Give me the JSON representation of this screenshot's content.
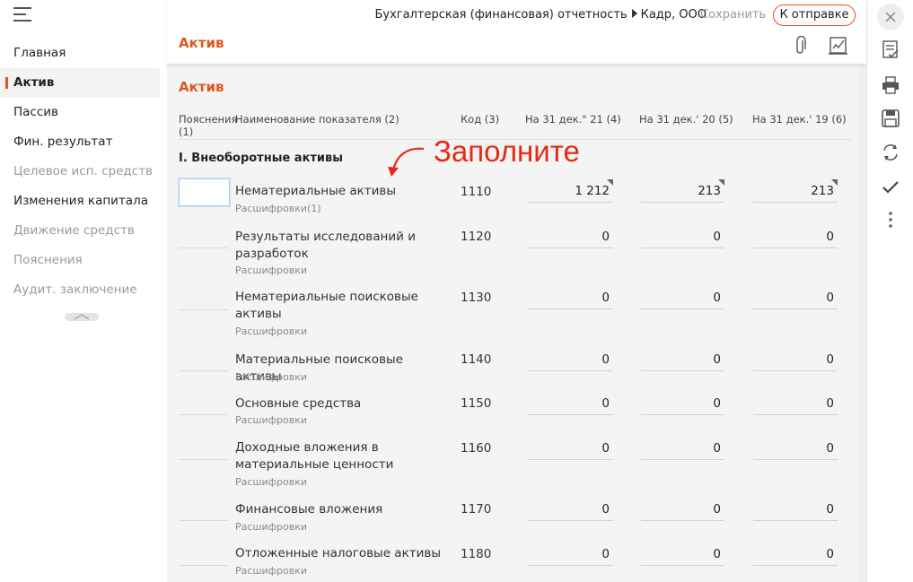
{
  "sidebar": {
    "items": [
      {
        "label": "Главная",
        "state": "normal"
      },
      {
        "label": "Актив",
        "state": "active"
      },
      {
        "label": "Пассив",
        "state": "normal"
      },
      {
        "label": "Фин. результат",
        "state": "normal"
      },
      {
        "label": "Целевое исп. средств",
        "state": "muted"
      },
      {
        "label": "Изменения капитала",
        "state": "normal"
      },
      {
        "label": "Движение средств",
        "state": "muted"
      },
      {
        "label": "Пояснения",
        "state": "muted"
      },
      {
        "label": "Аудит. заключение",
        "state": "muted"
      }
    ]
  },
  "header": {
    "breadcrumb_doc": "Бухгалтерская (финансовая) отчетность",
    "breadcrumb_org": "Кадр, ООО",
    "save_label": "Сохранить",
    "send_label": "К отправке",
    "page_title": "Актив"
  },
  "main": {
    "section_title": "Актив",
    "columns": {
      "explanations": "Пояснения (1)",
      "name": "Наименование показателя (2)",
      "code": "Код (3)",
      "col1": "На 31 дек.\" 21 (4)",
      "col2": "На 31 дек.' 20 (5)",
      "col3": "На 31 дек.' 19 (6)"
    },
    "group_title": "I. Внеоборотные активы",
    "annotation": "Заполните",
    "rows": [
      {
        "name": "Нематериальные активы",
        "sub": "Расшифровки(1)",
        "code": "1110",
        "v1": "1 212",
        "v2": "213",
        "v3": "213"
      },
      {
        "name": "Результаты исследований и разработок",
        "sub": "Расшифровки",
        "code": "1120",
        "v1": "0",
        "v2": "0",
        "v3": "0"
      },
      {
        "name": "Нематериальные поисковые активы",
        "sub": "Расшифровки",
        "code": "1130",
        "v1": "0",
        "v2": "0",
        "v3": "0"
      },
      {
        "name": "Материальные поисковые активы",
        "sub": "Расшифровки",
        "code": "1140",
        "v1": "0",
        "v2": "0",
        "v3": "0"
      },
      {
        "name": "Основные средства",
        "sub": "Расшифровки",
        "code": "1150",
        "v1": "0",
        "v2": "0",
        "v3": "0"
      },
      {
        "name": "Доходные вложения в материальные ценности",
        "sub": "Расшифровки",
        "code": "1160",
        "v1": "0",
        "v2": "0",
        "v3": "0"
      },
      {
        "name": "Финансовые вложения",
        "sub": "Расшифровки",
        "code": "1170",
        "v1": "0",
        "v2": "0",
        "v3": "0"
      },
      {
        "name": "Отложенные налоговые активы",
        "sub": "Расшифровки",
        "code": "1180",
        "v1": "0",
        "v2": "0",
        "v3": "0"
      }
    ]
  },
  "toolbar_icons": [
    "close-icon",
    "checklist-icon",
    "print-icon",
    "save-disk-icon",
    "exchange-icon",
    "check-icon",
    "more-vertical-icon"
  ],
  "colors": {
    "accent": "#e2561a",
    "annotation": "#e8280f"
  }
}
